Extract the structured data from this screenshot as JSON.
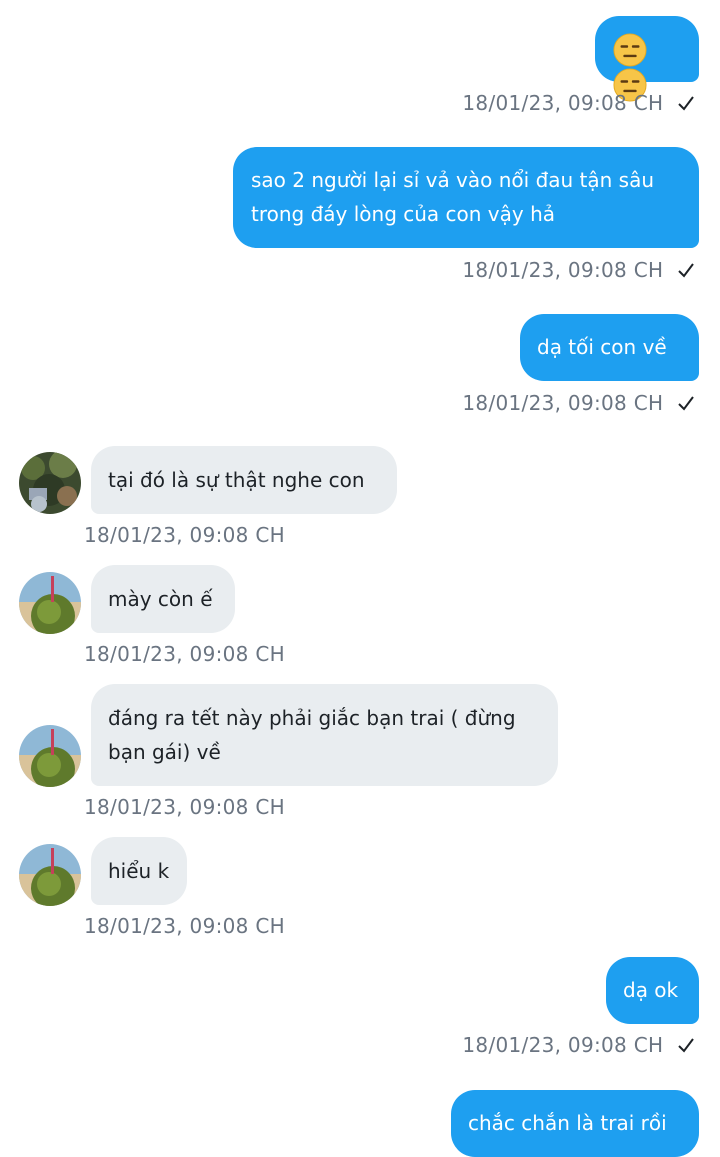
{
  "colors": {
    "outgoing_bubble": "#1e9ff0",
    "incoming_bubble": "#e9edf0",
    "timestamp": "#6a7481"
  },
  "messages": [
    {
      "direction": "out",
      "text": "😑😑",
      "emoji_names": [
        "expressionless-face-icon",
        "expressionless-face-icon"
      ],
      "time": "18/01/23,  09:08 CH",
      "status": "sent-check-icon"
    },
    {
      "direction": "out",
      "text": "sao 2 người lại sỉ vả vào nổi đau tận sâu trong đáy lòng của con vậy hả",
      "time": "18/01/23,  09:08 CH",
      "status": "sent-check-icon"
    },
    {
      "direction": "out",
      "text": "dạ tối con về",
      "time": "18/01/23,  09:08 CH",
      "status": "sent-check-icon"
    },
    {
      "direction": "in",
      "text": "tại đó là sự thật nghe con",
      "time": "18/01/23,  09:08 CH",
      "avatar": "avatar-garden"
    },
    {
      "direction": "in",
      "text": "mày còn ế",
      "time": "18/01/23,  09:08 CH",
      "avatar": "avatar-coconut-beach"
    },
    {
      "direction": "in",
      "text": "đáng ra tết này phải giắc bạn trai ( đừng bạn gái) về",
      "time": "18/01/23,  09:08 CH",
      "avatar": "avatar-coconut-beach"
    },
    {
      "direction": "in",
      "text": "hiểu k",
      "time": "18/01/23,  09:08 CH",
      "avatar": "avatar-coconut-beach"
    },
    {
      "direction": "out",
      "text": "dạ ok",
      "time": "18/01/23,  09:08 CH",
      "status": "sent-check-icon"
    },
    {
      "direction": "out",
      "text": "chắc chắn là trai rồi",
      "time": "",
      "status": ""
    }
  ]
}
